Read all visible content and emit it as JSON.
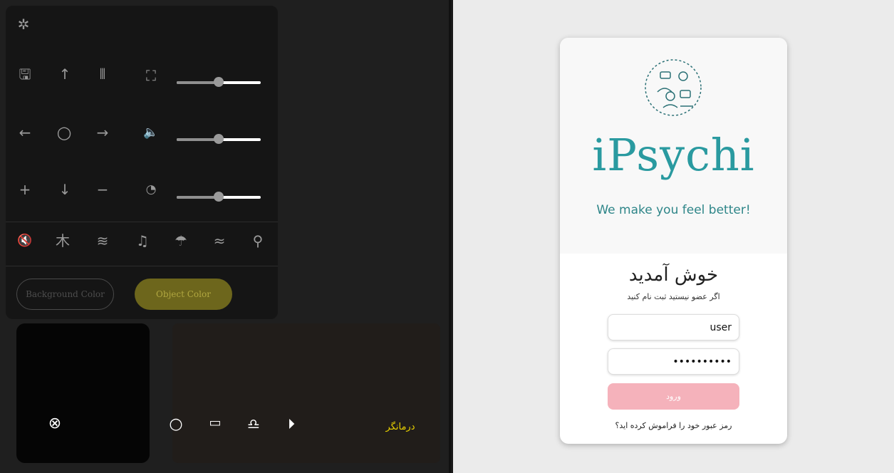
{
  "controls": {
    "background_color_label": "Background Color",
    "object_color_label": "Object Color",
    "sliders": [
      {
        "name": "zoom",
        "value": 0.5
      },
      {
        "name": "volume",
        "value": 0.5
      },
      {
        "name": "speed",
        "value": 0.5
      }
    ]
  },
  "video": {
    "therapist_label": "درمانگر"
  },
  "login": {
    "brand": "iPsychi",
    "tagline": "We make you feel better!",
    "welcome": "خوش آمدید",
    "subtitle": "اگر عضو نیستید ثبت نام کنید",
    "username_value": "user",
    "password_value": "••••••••••",
    "login_button": "ورود",
    "forgot_link": "رمز عبور خود را فراموش کرده اید؟"
  },
  "colors": {
    "brand": "#2a9aa0",
    "login_button": "#f5b2bb",
    "object_color": "#6d661c"
  }
}
